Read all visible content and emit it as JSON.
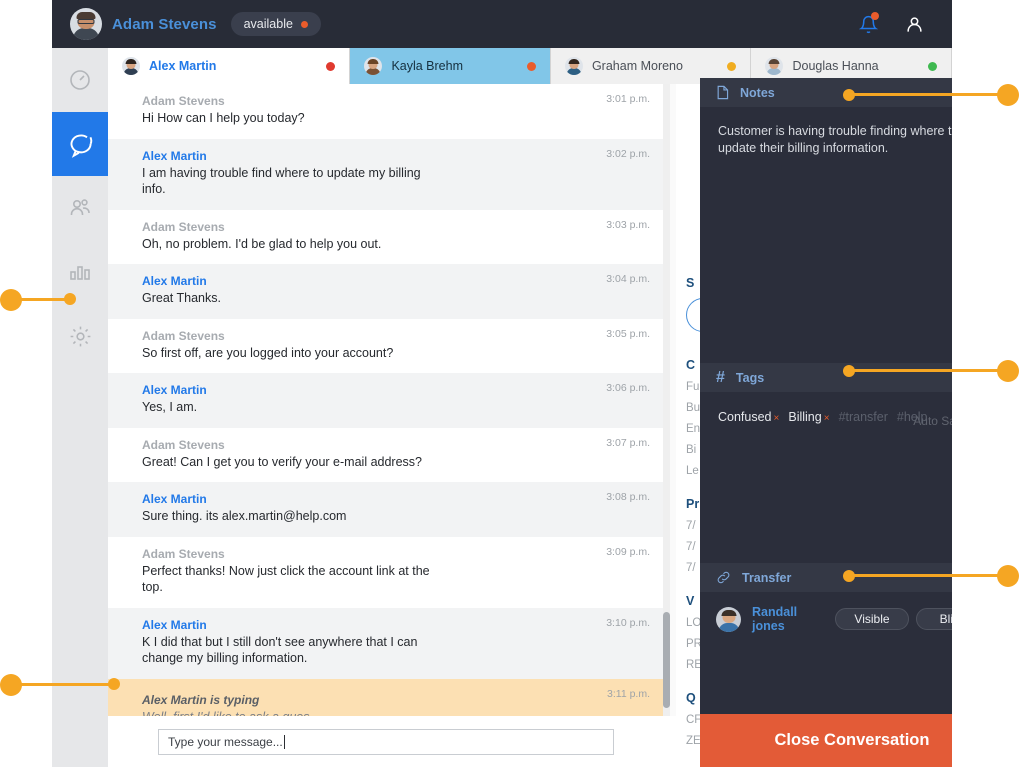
{
  "header": {
    "user_name": "Adam Stevens",
    "status_label": "available",
    "status_color": "#ea5c2b",
    "notification_icon": "bell-icon",
    "account_icon": "user-icon"
  },
  "sidebar": {
    "items": [
      {
        "icon": "dashboard-gauge-icon",
        "name": "dashboard",
        "active": false
      },
      {
        "icon": "chat-bubble-icon",
        "name": "chat",
        "active": true
      },
      {
        "icon": "users-icon",
        "name": "users",
        "active": false
      },
      {
        "icon": "bar-chart-icon",
        "name": "analytics",
        "active": false
      },
      {
        "icon": "gear-icon",
        "name": "settings",
        "active": false
      }
    ]
  },
  "tabs": [
    {
      "label": "Alex Martin",
      "status_color": "#e03a2f",
      "state": "first"
    },
    {
      "label": "Kayla Brehm",
      "status_color": "#ea5c2b",
      "state": "active"
    },
    {
      "label": "Graham Moreno",
      "status_color": "#f0ad21",
      "state": "normal"
    },
    {
      "label": "Douglas Hanna",
      "status_color": "#3fb950",
      "state": "normal"
    }
  ],
  "conversation": {
    "agent_name": "Adam Stevens",
    "customer_name": "Alex Martin",
    "messages": [
      {
        "author": "Adam Stevens",
        "role": "agent",
        "time": "3:01 p.m.",
        "text": "Hi How can I help you today?"
      },
      {
        "author": "Alex Martin",
        "role": "customer",
        "time": "3:02 p.m.",
        "text": "I am having trouble find where to update my billing info."
      },
      {
        "author": "Adam Stevens",
        "role": "agent",
        "time": "3:03 p.m.",
        "text": "Oh, no problem. I'd be glad to help you out."
      },
      {
        "author": "Alex Martin",
        "role": "customer",
        "time": "3:04 p.m.",
        "text": "Great Thanks."
      },
      {
        "author": "Adam Stevens",
        "role": "agent",
        "time": "3:05 p.m.",
        "text": "So first off, are you logged into your account?"
      },
      {
        "author": "Alex Martin",
        "role": "customer",
        "time": "3:06 p.m.",
        "text": "Yes, I am."
      },
      {
        "author": "Adam Stevens",
        "role": "agent",
        "time": "3:07 p.m.",
        "text": "Great! Can I get you to verify your e-mail address?"
      },
      {
        "author": "Alex Martin",
        "role": "customer",
        "time": "3:08 p.m.",
        "text": "Sure thing. its alex.martin@help.com"
      },
      {
        "author": "Adam Stevens",
        "role": "agent",
        "time": "3:09 p.m.",
        "text": "Perfect thanks! Now just click the account link at the top."
      },
      {
        "author": "Alex Martin",
        "role": "customer",
        "time": "3:10 p.m.",
        "text": "K I did that but I still don't see anywhere that I can change my billing information."
      },
      {
        "author": "Alex Martin is typing",
        "role": "typing",
        "time": "3:11 p.m.",
        "text": "Well, first I'd like to ask a ques..."
      }
    ],
    "composer_value": "Type your message...",
    "composer_placeholder": "Type your message..."
  },
  "info_panel": {
    "sections": [
      {
        "heading": "S",
        "rows": []
      },
      {
        "heading": "C",
        "rows": [
          "Fu",
          "Bu",
          "En",
          "Bi",
          "Le"
        ]
      },
      {
        "heading": "Pr",
        "rows": [
          "7/",
          "7/",
          "7/"
        ]
      },
      {
        "heading": "V",
        "rows": [
          "LO",
          "PR",
          "RE"
        ]
      },
      {
        "heading": "Q",
        "rows": [
          "CF",
          "ZE"
        ]
      }
    ]
  },
  "right_panel": {
    "notes": {
      "title": "Notes",
      "icon": "document-icon",
      "body": "Customer is having trouble finding where to update their billing information.",
      "autosave_label": "Auto Saving..."
    },
    "tags": {
      "title": "Tags",
      "icon": "hash-icon",
      "applied": [
        {
          "label": "Confused",
          "remove": "×"
        },
        {
          "label": "Billing",
          "remove": "×"
        }
      ],
      "suggested": [
        "#transfer",
        "#help"
      ]
    },
    "transfer": {
      "title": "Transfer",
      "icon": "link-icon",
      "agent_name": "Randall jones",
      "buttons": [
        {
          "label": "Visible"
        },
        {
          "label": "Blind"
        }
      ]
    },
    "close_button_label": "Close Conversation",
    "close_button_color": "#e35b37"
  },
  "theme": {
    "header_bg": "#282c37",
    "panel_bg": "#2b2e3b",
    "section_header_bg": "#343845",
    "accent_blue": "#2279e8",
    "link_blue": "#4a90d9",
    "callout_orange": "#f5a623",
    "typing_highlight": "#fce0b3"
  }
}
